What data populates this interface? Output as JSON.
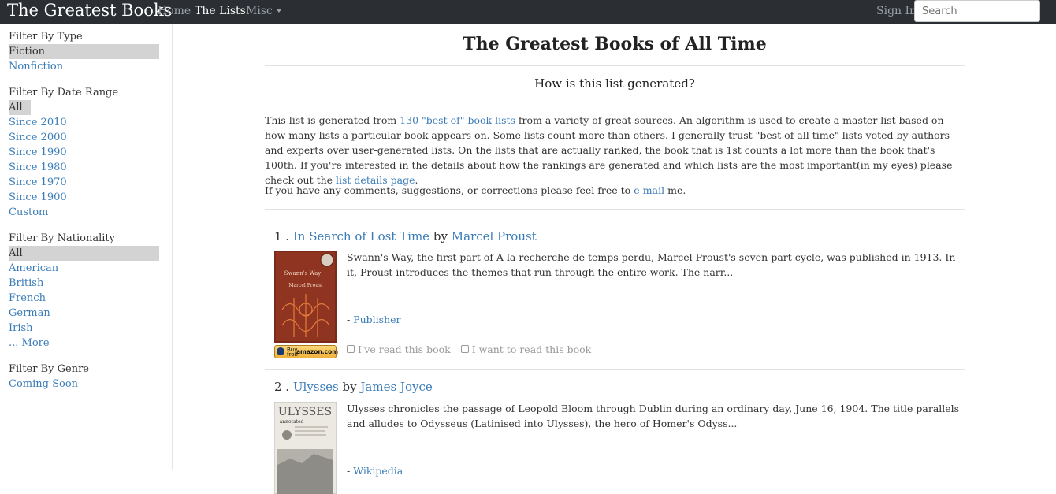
{
  "nav": {
    "brand": "The Greatest Books",
    "home": "Home",
    "lists": "The Lists",
    "misc": "Misc",
    "sign_in": "Sign In",
    "search_placeholder": "Search"
  },
  "sidebar": {
    "type": {
      "title": "Filter By Type",
      "items": [
        "Fiction",
        "Nonfiction"
      ]
    },
    "date": {
      "title": "Filter By Date Range",
      "items": [
        "All",
        "Since 2010",
        "Since 2000",
        "Since 1990",
        "Since 1980",
        "Since 1970",
        "Since 1900",
        "Custom"
      ]
    },
    "nationality": {
      "title": "Filter By Nationality",
      "items": [
        "All",
        "American",
        "British",
        "French",
        "German",
        "Irish",
        "... More"
      ]
    },
    "genre": {
      "title": "Filter By Genre",
      "items": [
        "Coming Soon"
      ]
    }
  },
  "main": {
    "title": "The Greatest Books of All Time",
    "subtitle": "How is this list generated?",
    "intro": {
      "p1_a": "This list is generated from ",
      "p1_link1": "130 \"best of\" book lists",
      "p1_b": " from a variety of great sources. An algorithm is used to create a master list based on how many lists a particular book appears on. Some lists count more than others. I generally trust \"best of all time\" lists voted by authors and experts over user-generated lists. On the lists that are actually ranked, the book that is 1st counts a lot more than the book that's 100th. If you're interested in the details about how the rankings are generated and which lists are the most important(in my eyes) please check out the ",
      "p1_link2": "list details page",
      "p1_c": ".",
      "p2_a": "If you have any comments, suggestions, or corrections please feel free to ",
      "p2_link": "e-mail",
      "p2_b": " me."
    },
    "books": [
      {
        "rank": "1 .",
        "title": "In Search of Lost Time",
        "by": "by",
        "author": "Marcel Proust",
        "description": "Swann's Way, the first part of A la recherche de temps perdu, Marcel Proust's seven-part cycle, was published in 1913. In it, Proust introduces the themes that run through the entire work. The narr...",
        "source_prefix": "- ",
        "source": "Publisher",
        "read": "I've read this book",
        "want": "I want to read this book",
        "cover_title": "Swann's Way",
        "cover_author": "Marcel Proust",
        "amazon_top": "Buy",
        "amazon_from": "from",
        "amazon_brand": "amazon.com"
      },
      {
        "rank": "2 .",
        "title": "Ulysses",
        "by": "by",
        "author": "James Joyce",
        "description": "Ulysses chronicles the passage of Leopold Bloom through Dublin during an ordinary day, June 16, 1904. The title parallels and alludes to Odysseus (Latinised into Ulysses), the hero of Homer's Odyss...",
        "source_prefix": "- ",
        "source": "Wikipedia",
        "cover_title": "ULYSSES",
        "cover_sub": "annotated"
      }
    ]
  },
  "colors": {
    "navbar": "#2b2f33",
    "link": "#3a7cb8",
    "selected_bg": "#d3d3d3"
  }
}
